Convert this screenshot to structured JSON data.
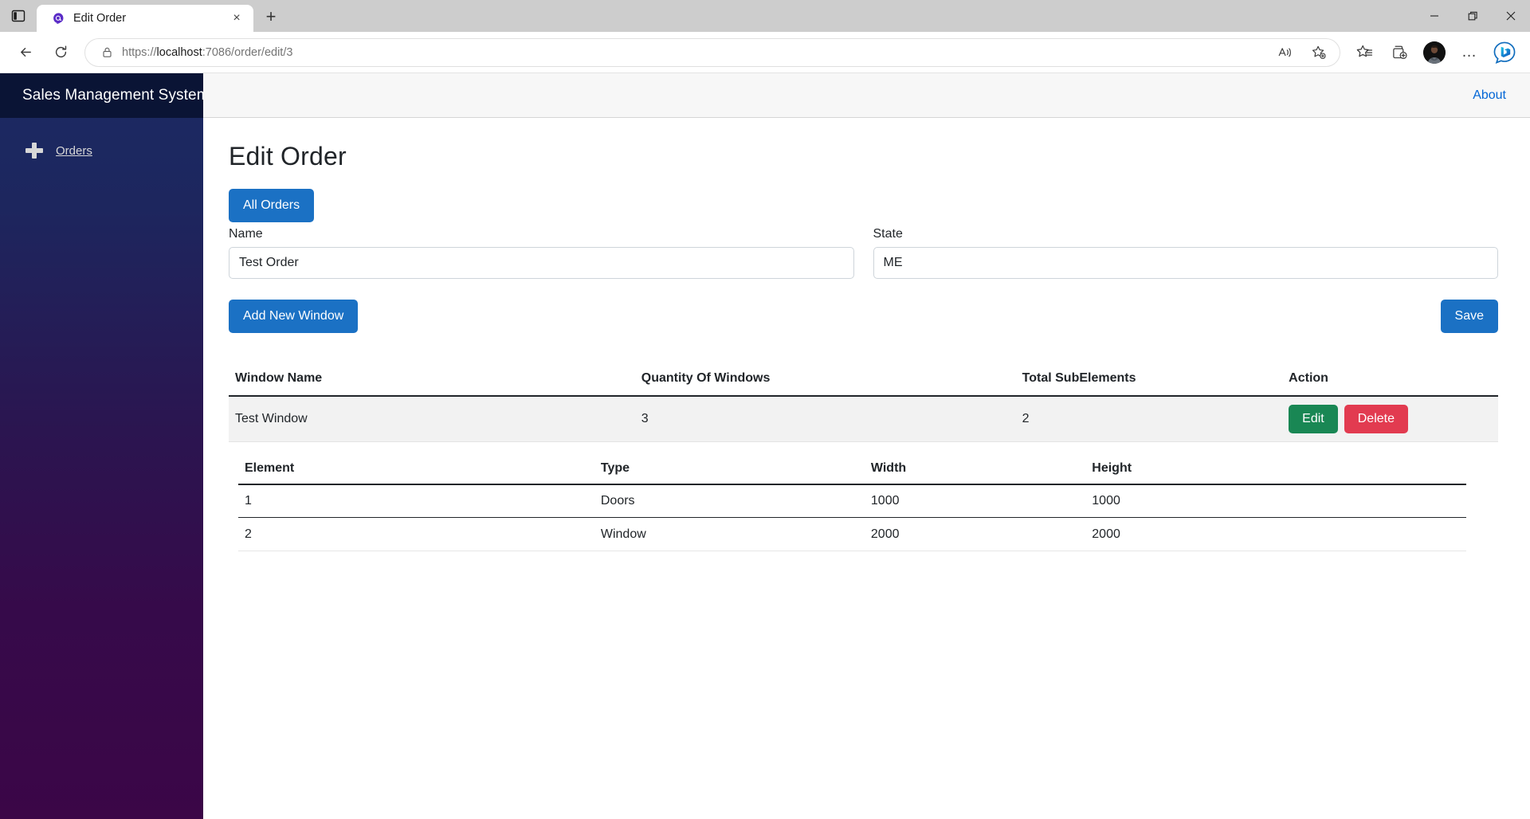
{
  "browser": {
    "tab_strip_icon": "tab-list-icon",
    "tab": {
      "title": "Edit Order",
      "favicon": "blazor-icon",
      "close": "×"
    },
    "new_tab_label": "+",
    "window_controls": {
      "minimize": "—",
      "maximize": "❐",
      "close": "✕"
    },
    "toolbar": {
      "back": "back-arrow-icon",
      "reload": "reload-icon",
      "lock": "lock-icon",
      "url_prefix": "https://",
      "url_host": "localhost",
      "url_rest": ":7086/order/edit/3",
      "url_full": "https://localhost:7086/order/edit/3",
      "read_aloud": "read-aloud-icon",
      "add_favorite": "add-favorite-icon",
      "favorites": "favorites-icon",
      "collections": "collections-icon",
      "profile": "profile-avatar",
      "settings_more": "…",
      "copilot": "bing-copilot-icon"
    }
  },
  "app": {
    "brand": "Sales Management System",
    "sidebar": {
      "items": [
        {
          "label": "Orders",
          "icon": "plus-icon"
        }
      ]
    },
    "topbar": {
      "about_label": "About"
    }
  },
  "page": {
    "title": "Edit Order",
    "all_orders_button": "All Orders",
    "form": {
      "name_label": "Name",
      "name_value": "Test Order",
      "state_label": "State",
      "state_value": "ME"
    },
    "add_window_button": "Add New Window",
    "save_button": "Save",
    "windows_table": {
      "headers": [
        "Window Name",
        "Quantity Of Windows",
        "Total SubElements",
        "Action"
      ],
      "rows": [
        {
          "window_name": "Test Window",
          "quantity": "3",
          "total_subelements": "2",
          "edit_label": "Edit",
          "delete_label": "Delete"
        }
      ]
    },
    "elements_table": {
      "headers": [
        "Element",
        "Type",
        "Width",
        "Height"
      ],
      "rows": [
        {
          "element": "1",
          "type": "Doors",
          "width": "1000",
          "height": "1000"
        },
        {
          "element": "2",
          "type": "Window",
          "width": "2000",
          "height": "2000"
        }
      ]
    }
  },
  "colors": {
    "brand_bar": "#0a1435",
    "sidebar_top": "#1b2a63",
    "sidebar_bottom": "#3b0647",
    "primary": "#1b71c4",
    "success": "#198754",
    "danger": "#e23b50",
    "link": "#0366d6"
  }
}
